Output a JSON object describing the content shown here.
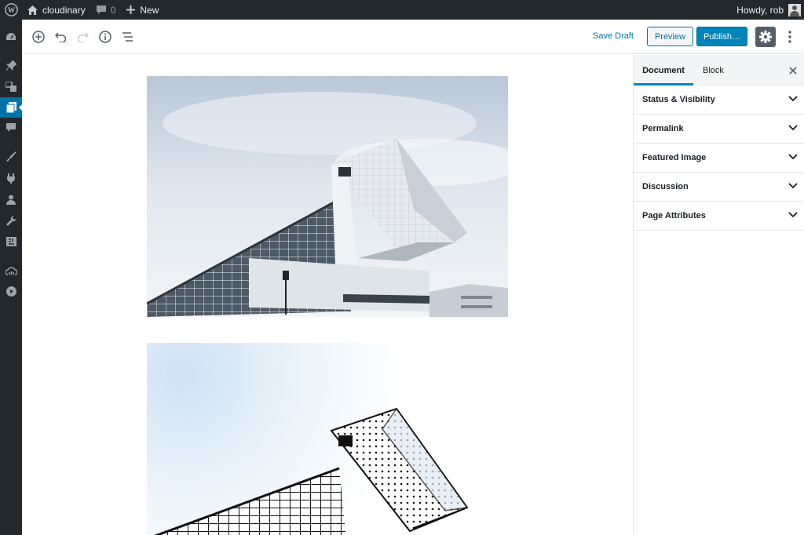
{
  "admin_bar": {
    "site_name": "cloudinary",
    "comments_count": "0",
    "new_label": "New",
    "greeting": "Howdy, rob"
  },
  "toolbar": {
    "save_draft": "Save Draft",
    "preview": "Preview",
    "publish": "Publish…"
  },
  "sidebar": {
    "tabs": [
      {
        "label": "Document",
        "active": true
      },
      {
        "label": "Block",
        "active": false
      }
    ],
    "panels": [
      {
        "label": "Status & Visibility"
      },
      {
        "label": "Permalink"
      },
      {
        "label": "Featured Image"
      },
      {
        "label": "Discussion"
      },
      {
        "label": "Page Attributes"
      }
    ]
  },
  "colors": {
    "admin_bar_bg": "#23282d",
    "accent": "#0085ba",
    "link": "#0073aa"
  }
}
